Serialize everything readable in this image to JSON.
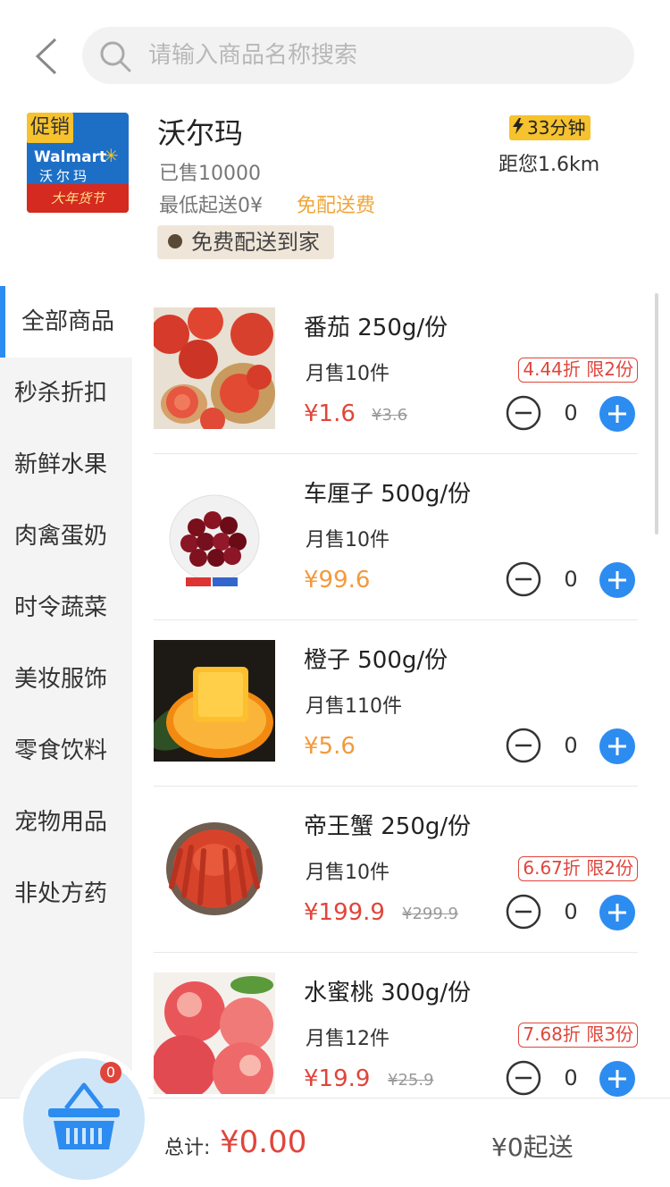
{
  "header": {
    "search_placeholder": "请输入商品名称搜索"
  },
  "store": {
    "promo_tag": "促销",
    "logo_brand": "Walmart",
    "logo_brand_cn": "沃尔玛",
    "logo_banner": "大年货节",
    "name": "沃尔玛",
    "sold": "已售10000",
    "min_order": "最低起送0¥",
    "delivery_fee": "免配送费",
    "free_delivery_tag": "免费配送到家",
    "delivery_time": "33分钟",
    "distance": "距您1.6km",
    "colors": {
      "accent": "#2d8cf0",
      "price_red": "#e0453b",
      "price_orange": "#f39a3c",
      "tag_yellow": "#f6c22d"
    }
  },
  "categories": [
    {
      "label": "全部商品",
      "active": true
    },
    {
      "label": "秒杀折扣"
    },
    {
      "label": "新鲜水果"
    },
    {
      "label": "肉禽蛋奶"
    },
    {
      "label": "时令蔬菜"
    },
    {
      "label": "美妆服饰"
    },
    {
      "label": "零食饮料"
    },
    {
      "label": "宠物用品"
    },
    {
      "label": "非处方药"
    }
  ],
  "products": [
    {
      "name": "番茄 250g/份",
      "sold": "月售10件",
      "price": "¥1.6",
      "original_price": "¥3.6",
      "discount": "4.44折 限2份",
      "qty": "0",
      "image": "tomato-image"
    },
    {
      "name": "车厘子 500g/份",
      "sold": "月售10件",
      "price": "¥99.6",
      "original_price": "",
      "discount": "",
      "qty": "0",
      "image": "cherry-image"
    },
    {
      "name": "橙子 500g/份",
      "sold": "月售110件",
      "price": "¥5.6",
      "original_price": "",
      "discount": "",
      "qty": "0",
      "image": "orange-image"
    },
    {
      "name": "帝王蟹 250g/份",
      "sold": "月售10件",
      "price": "¥199.9",
      "original_price": "¥299.9",
      "discount": "6.67折 限2份",
      "qty": "0",
      "image": "king-crab-image"
    },
    {
      "name": "水蜜桃 300g/份",
      "sold": "月售12件",
      "price": "¥19.9",
      "original_price": "¥25.9",
      "discount": "7.68折 限3份",
      "qty": "0",
      "image": "peach-image"
    }
  ],
  "cart": {
    "count": "0",
    "total_label": "总计:",
    "total_value": "¥0.00",
    "min_order_label": "¥0起送"
  }
}
